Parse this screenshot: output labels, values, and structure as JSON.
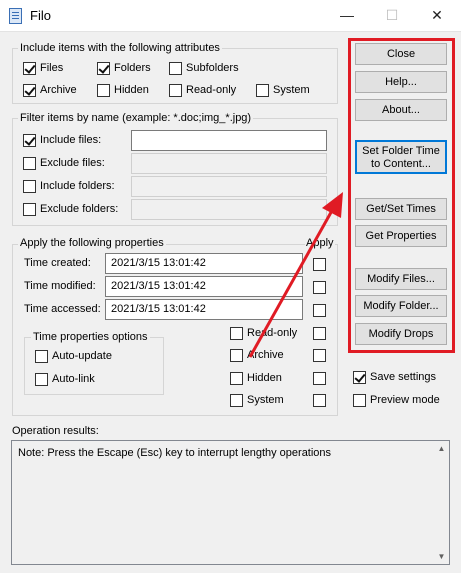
{
  "window": {
    "title": "Filo",
    "minimize": "—",
    "maximize": "☐",
    "close": "✕"
  },
  "attributes_group": {
    "title": "Include items with the following attributes",
    "items": [
      {
        "label": "Files",
        "checked": true
      },
      {
        "label": "Folders",
        "checked": true
      },
      {
        "label": "Subfolders",
        "checked": false
      },
      {
        "label": "Archive",
        "checked": true
      },
      {
        "label": "Hidden",
        "checked": false
      },
      {
        "label": "Read-only",
        "checked": false
      },
      {
        "label": "System",
        "checked": false
      }
    ]
  },
  "filter_group": {
    "title": "Filter items by name (example: *.doc;img_*.jpg)",
    "rows": [
      {
        "label": "Include files:",
        "checked": true,
        "value": ""
      },
      {
        "label": "Exclude files:",
        "checked": false,
        "value": ""
      },
      {
        "label": "Include folders:",
        "checked": false,
        "value": ""
      },
      {
        "label": "Exclude folders:",
        "checked": false,
        "value": ""
      }
    ]
  },
  "properties_group": {
    "title": "Apply the following properties",
    "apply_label": "Apply",
    "rows": [
      {
        "label": "Time created:",
        "value": "2021/3/15 13:01:42"
      },
      {
        "label": "Time modified:",
        "value": "2021/3/15 13:01:42"
      },
      {
        "label": "Time accessed:",
        "value": "2021/3/15 13:01:42"
      }
    ],
    "attr_rows": [
      {
        "label": "Read-only"
      },
      {
        "label": "Archive"
      },
      {
        "label": "Hidden"
      },
      {
        "label": "System"
      }
    ],
    "options_title": "Time properties options",
    "options": [
      {
        "label": "Auto-update",
        "checked": false
      },
      {
        "label": "Auto-link",
        "checked": false
      }
    ]
  },
  "buttons": {
    "close": "Close",
    "help": "Help...",
    "about": "About...",
    "set_folder_time_line1": "Set Folder Time",
    "set_folder_time_line2": "to Content...",
    "get_set_times": "Get/Set Times",
    "get_properties": "Get Properties",
    "modify_files": "Modify Files...",
    "modify_folder": "Modify Folder...",
    "modify_drops": "Modify Drops"
  },
  "side_options": [
    {
      "label": "Save settings",
      "checked": true
    },
    {
      "label": "Preview mode",
      "checked": false
    }
  ],
  "results": {
    "title": "Operation results:",
    "text": "Note: Press the Escape (Esc) key to interrupt lengthy operations"
  },
  "colors": {
    "annotation_red": "#e01b24",
    "focus_blue": "#0078d7"
  }
}
